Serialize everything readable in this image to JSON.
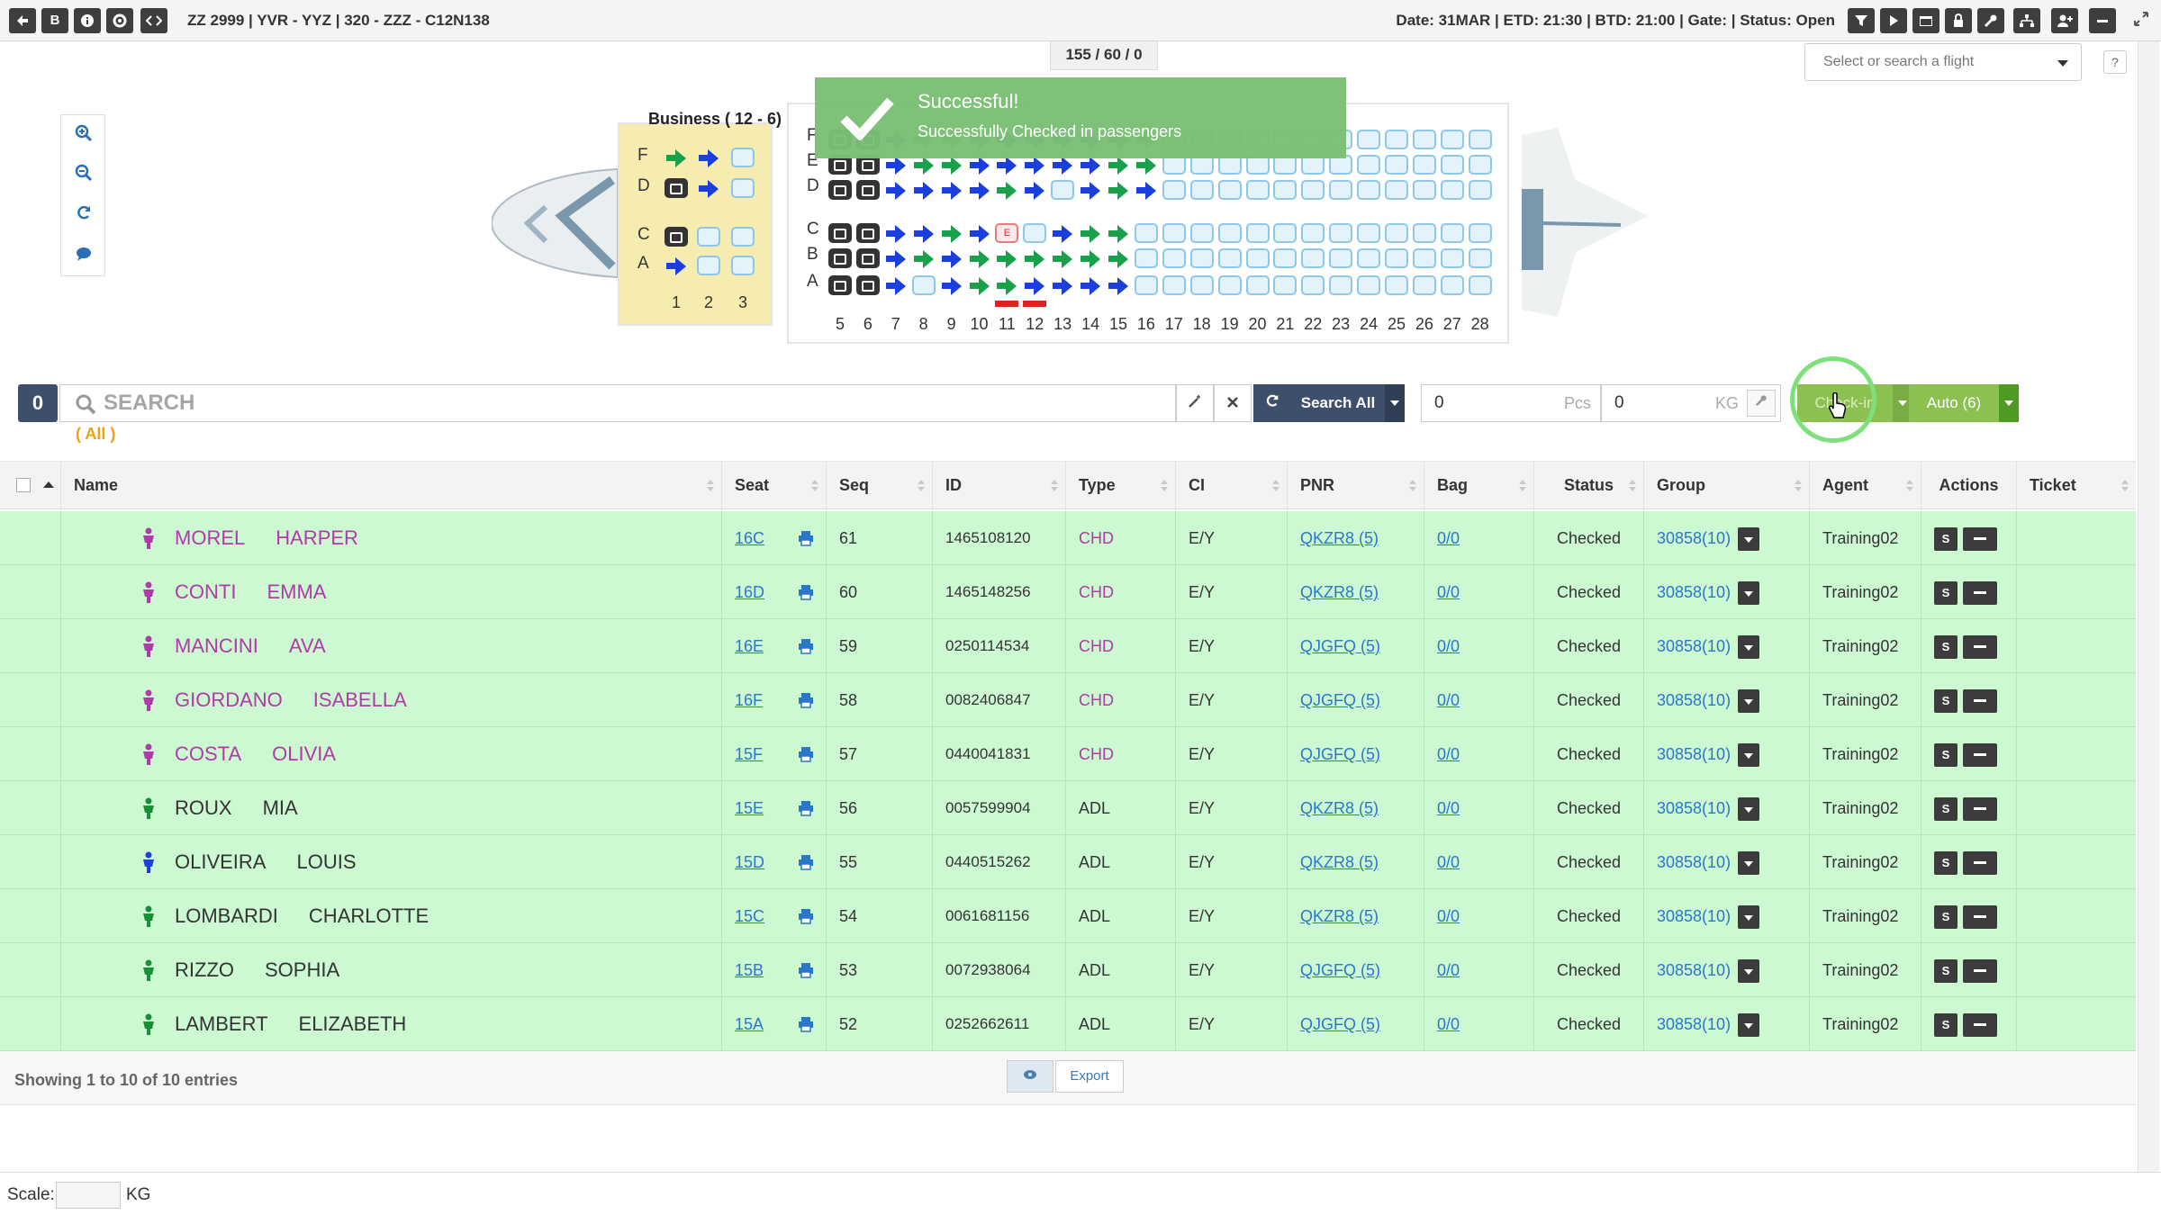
{
  "topbar": {
    "buttons": [
      "back",
      "B",
      "info",
      "gear",
      "code"
    ],
    "flight_title": "ZZ 2999 | YVR - YYZ | 320 - ZZZ - C12N138",
    "flight_status": "Date: 31MAR | ETD: 21:30 | BTD: 21:00 | Gate: | Status: Open",
    "right_icons": [
      "filter-icon",
      "play-icon",
      "window-icon",
      "lock-icon",
      "wrench-icon",
      "sitemap-icon",
      "user-add-icon",
      "minus-icon"
    ]
  },
  "counter": "155 / 60 / 0",
  "flight_select": {
    "placeholder": "Select or search a flight"
  },
  "help_label": "?",
  "seatmap": {
    "business_label": "Business ( 12 - 6)",
    "business_rows": [
      "F",
      "D",
      "C",
      "A"
    ],
    "business_cols": [
      "1",
      "2",
      "3"
    ],
    "economy_rows": [
      "F",
      "E",
      "D",
      "C",
      "B",
      "A"
    ],
    "economy_cols": [
      "5",
      "6",
      "7",
      "8",
      "9",
      "10",
      "11",
      "12",
      "13",
      "14",
      "15",
      "16",
      "17",
      "18",
      "19",
      "20",
      "21",
      "22",
      "23",
      "24",
      "25",
      "26",
      "27",
      "28"
    ],
    "special_seat_label": "E"
  },
  "toast": {
    "title": "Successful!",
    "message": "Successfully Checked in passengers"
  },
  "search": {
    "count": "0",
    "placeholder": "SEARCH",
    "filter": "( All )",
    "search_all_label": "Search All",
    "pcs_value": "0",
    "pcs_unit": "Pcs",
    "kg_value": "0",
    "kg_unit": "KG",
    "checkin_label": "Check-in",
    "auto_label": "Auto (6)"
  },
  "table": {
    "columns": [
      "Name",
      "Seat",
      "Seq",
      "ID",
      "Type",
      "CI",
      "PNR",
      "Bag",
      "Status",
      "Group",
      "Agent",
      "Actions",
      "Ticket"
    ],
    "rows": [
      {
        "last": "MOREL",
        "first": "HARPER",
        "seat": "16C",
        "seq": "61",
        "id": "1465108120",
        "type": "CHD",
        "ci": "E/Y",
        "pnr": "QKZR8 (5)",
        "bag": "0/0",
        "status": "Checked",
        "group": "30858(10)",
        "agent": "Training02",
        "action": "S"
      },
      {
        "last": "CONTI",
        "first": "EMMA",
        "seat": "16D",
        "seq": "60",
        "id": "1465148256",
        "type": "CHD",
        "ci": "E/Y",
        "pnr": "QKZR8 (5)",
        "bag": "0/0",
        "status": "Checked",
        "group": "30858(10)",
        "agent": "Training02",
        "action": "S"
      },
      {
        "last": "MANCINI",
        "first": "AVA",
        "seat": "16E",
        "seq": "59",
        "id": "0250114534",
        "type": "CHD",
        "ci": "E/Y",
        "pnr": "QJGFQ (5)",
        "bag": "0/0",
        "status": "Checked",
        "group": "30858(10)",
        "agent": "Training02",
        "action": "S"
      },
      {
        "last": "GIORDANO",
        "first": "ISABELLA",
        "seat": "16F",
        "seq": "58",
        "id": "0082406847",
        "type": "CHD",
        "ci": "E/Y",
        "pnr": "QJGFQ (5)",
        "bag": "0/0",
        "status": "Checked",
        "group": "30858(10)",
        "agent": "Training02",
        "action": "S"
      },
      {
        "last": "COSTA",
        "first": "OLIVIA",
        "seat": "15F",
        "seq": "57",
        "id": "0440041831",
        "type": "CHD",
        "ci": "E/Y",
        "pnr": "QJGFQ (5)",
        "bag": "0/0",
        "status": "Checked",
        "group": "30858(10)",
        "agent": "Training02",
        "action": "S"
      },
      {
        "last": "ROUX",
        "first": "MIA",
        "seat": "15E",
        "seq": "56",
        "id": "0057599904",
        "type": "ADL",
        "ci": "E/Y",
        "pnr": "QKZR8 (5)",
        "bag": "0/0",
        "status": "Checked",
        "group": "30858(10)",
        "agent": "Training02",
        "action": "S"
      },
      {
        "last": "OLIVEIRA",
        "first": "LOUIS",
        "seat": "15D",
        "seq": "55",
        "id": "0440515262",
        "type": "ADL",
        "ci": "E/Y",
        "pnr": "QKZR8 (5)",
        "bag": "0/0",
        "status": "Checked",
        "group": "30858(10)",
        "agent": "Training02",
        "action": "S"
      },
      {
        "last": "LOMBARDI",
        "first": "CHARLOTTE",
        "seat": "15C",
        "seq": "54",
        "id": "0061681156",
        "type": "ADL",
        "ci": "E/Y",
        "pnr": "QKZR8 (5)",
        "bag": "0/0",
        "status": "Checked",
        "group": "30858(10)",
        "agent": "Training02",
        "action": "S"
      },
      {
        "last": "RIZZO",
        "first": "SOPHIA",
        "seat": "15B",
        "seq": "53",
        "id": "0072938064",
        "type": "ADL",
        "ci": "E/Y",
        "pnr": "QJGFQ (5)",
        "bag": "0/0",
        "status": "Checked",
        "group": "30858(10)",
        "agent": "Training02",
        "action": "S"
      },
      {
        "last": "LAMBERT",
        "first": "ELIZABETH",
        "seat": "15A",
        "seq": "52",
        "id": "0252662611",
        "type": "ADL",
        "ci": "E/Y",
        "pnr": "QJGFQ (5)",
        "bag": "0/0",
        "status": "Checked",
        "group": "30858(10)",
        "agent": "Training02",
        "action": "S"
      }
    ],
    "footer_text": "Showing 1 to 10 of 10 entries",
    "export_label": "Export"
  },
  "bottom": {
    "scale_label": "Scale:",
    "scale_unit": "KG"
  },
  "colors": {
    "row_bg": "#cdf9d2",
    "child": "#b23aa8",
    "link": "#2a77c9",
    "checked_seat": "#19a04a",
    "occupied_seat": "#1a3fdc"
  }
}
